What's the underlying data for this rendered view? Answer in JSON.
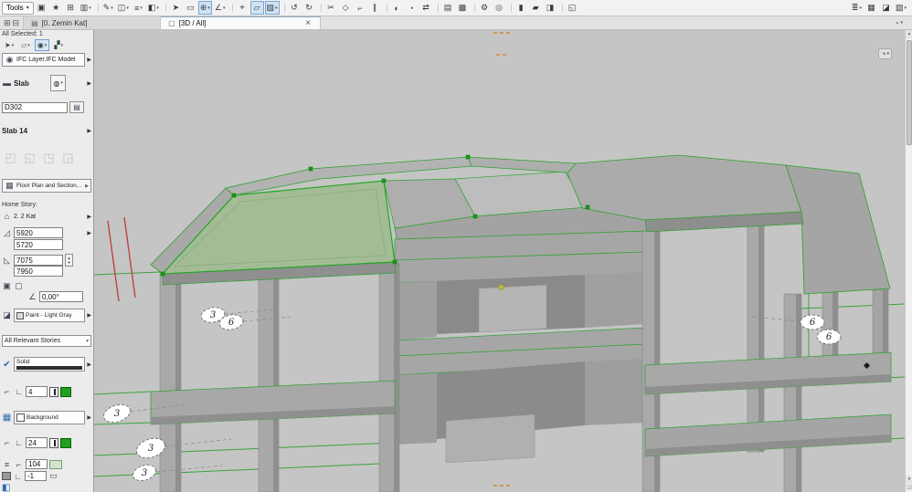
{
  "glyphs": {
    "caret": "▾",
    "expand": "▶",
    "close": "×",
    "up": "▴",
    "down": "▾",
    "eye": "◉",
    "slab": "▬",
    "reno": "◍",
    "list": "▤",
    "plan": "▦",
    "home": "⌂",
    "coord_x": "◿",
    "coord_y": "◺",
    "rel1": "▣",
    "rel2": "▢",
    "angle": "∠",
    "surface": "◪",
    "fillcut": "✔",
    "bgfill": "▦",
    "pen_a": "⌐",
    "pen_b": "∟",
    "pattern": "≡",
    "display": "▭",
    "nav": "◔",
    "corner": "◲",
    "panel": "◧"
  },
  "toolbar": {
    "tools_label": "Tools",
    "icons": [
      {
        "glyph": "▣",
        "name": "project-settings-icon"
      },
      {
        "glyph": "★",
        "name": "favorites-icon"
      },
      {
        "glyph": "⊞",
        "name": "quick-layers-icon"
      },
      {
        "glyph": "▥",
        "name": "stories-icon",
        "caret": true
      },
      {
        "glyph": "✎",
        "name": "pen-set-icon",
        "caret": true,
        "sep": true
      },
      {
        "glyph": "◫",
        "name": "fill-type-icon",
        "caret": true
      },
      {
        "glyph": "≡",
        "name": "line-type-icon",
        "caret": true
      },
      {
        "glyph": "◧",
        "name": "surface-icon",
        "caret": true
      },
      {
        "glyph": "➤",
        "name": "arrow-tool-icon",
        "sep": true
      },
      {
        "glyph": "▭",
        "name": "marquee-tool-icon"
      },
      {
        "glyph": "⊕",
        "name": "snap-point-icon",
        "caret": true,
        "active": true
      },
      {
        "glyph": "∠",
        "name": "snap-guide-icon",
        "caret": true
      },
      {
        "glyph": "⌖",
        "name": "origin-icon",
        "sep": true
      },
      {
        "glyph": "▱",
        "name": "guide-lines-icon",
        "active": true
      },
      {
        "glyph": "▨",
        "name": "snap-grid-icon",
        "caret": true,
        "active": true
      },
      {
        "glyph": "↺",
        "name": "undo-icon",
        "sep": true
      },
      {
        "glyph": "↻",
        "name": "redo-icon"
      },
      {
        "glyph": "✂",
        "name": "trim-icon",
        "sep": true
      },
      {
        "glyph": "◇",
        "name": "split-icon"
      },
      {
        "glyph": "⌐",
        "name": "adjust-icon"
      },
      {
        "glyph": "∥",
        "name": "offset-icon"
      },
      {
        "glyph": "◐",
        "name": "mirror-icon",
        "sep": true
      },
      {
        "glyph": "◔",
        "name": "rotate-icon"
      },
      {
        "glyph": "⇄",
        "name": "multiply-icon"
      },
      {
        "glyph": "▤",
        "name": "group-icon",
        "sep": true
      },
      {
        "glyph": "▩",
        "name": "lock-icon"
      },
      {
        "glyph": "⚙",
        "name": "options-icon",
        "sep": true
      },
      {
        "glyph": "◎",
        "name": "check-elements-icon"
      },
      {
        "glyph": "▮",
        "name": "section-tool-icon",
        "sep": true
      },
      {
        "glyph": "▰",
        "name": "elevation-tool-icon"
      },
      {
        "glyph": "◨",
        "name": "camera-tool-icon"
      },
      {
        "glyph": "◱",
        "name": "zoom-fit-icon",
        "sep": true
      }
    ],
    "right_icons": [
      {
        "glyph": "≣",
        "name": "palette-layout-icon",
        "caret": true
      },
      {
        "glyph": "▦",
        "name": "organizer-icon"
      },
      {
        "glyph": "◪",
        "name": "teamwork-icon"
      },
      {
        "glyph": "▧",
        "name": "library-manager-icon",
        "caret": true
      }
    ]
  },
  "tabbar": {
    "window_icons": [
      {
        "glyph": "⊞",
        "name": "tab-overview-icon"
      },
      {
        "glyph": "⊟",
        "name": "split-view-icon"
      }
    ],
    "tabs": [
      {
        "icon": "▤",
        "label": "[0. Zemin Kat]"
      },
      {
        "icon": "▢",
        "label": "[3D / All]"
      }
    ]
  },
  "sidebar": {
    "selected_info": "All Selected: 1",
    "mini_icons": [
      {
        "glyph": "➤",
        "name": "select-arrow-icon",
        "caret": true
      },
      {
        "glyph": "▱",
        "name": "geometry-method-icon",
        "caret": true
      },
      {
        "glyph": "◉",
        "name": "magnet-snap-icon",
        "active": true
      },
      {
        "glyph": "▞",
        "name": "construction-method-icon",
        "caret": true
      }
    ],
    "layer_name": "IFC Layer.IFC Model",
    "tool_name": "Slab",
    "id_value": "D302",
    "element_title": "Slab 14",
    "geometry_icons": [
      {
        "glyph": "◰",
        "name": "slab-geometry-1-icon"
      },
      {
        "glyph": "◱",
        "name": "slab-geometry-2-icon"
      },
      {
        "glyph": "◳",
        "name": "slab-geometry-3-icon"
      },
      {
        "glyph": "◲",
        "name": "slab-geometry-4-icon"
      }
    ],
    "floor_plan_button": "Floor Plan and Section...",
    "home_story_label": "Home Story:",
    "home_story_value": "2. 2 Kat",
    "coord_x1": "5920",
    "coord_x2": "5720",
    "coord_y1": "7075",
    "coord_y2": "7950",
    "angle_value": "0,00°",
    "surface_value": "Paint - Light Gray",
    "stories_value": "All Relevant Stories",
    "fill_value": "Solid",
    "pen1_value": "4",
    "background_label": "Background",
    "pen2_value": "24",
    "pen3_value": "104",
    "pen4_value": "-1"
  },
  "viewport": {
    "bubbles": [
      {
        "label": "3"
      },
      {
        "label": "6"
      },
      {
        "label": "6"
      },
      {
        "label": "6"
      },
      {
        "label": "3"
      },
      {
        "label": "3"
      },
      {
        "label": "3"
      }
    ]
  },
  "colors": {
    "selection_green": "#23a623",
    "selected_slab_fill": "#a3bc96",
    "grid_green": "#3aa33a",
    "section_red": "#c24242",
    "viewport_bg": "#c5c5c5",
    "concrete": "#a8a8a8"
  }
}
